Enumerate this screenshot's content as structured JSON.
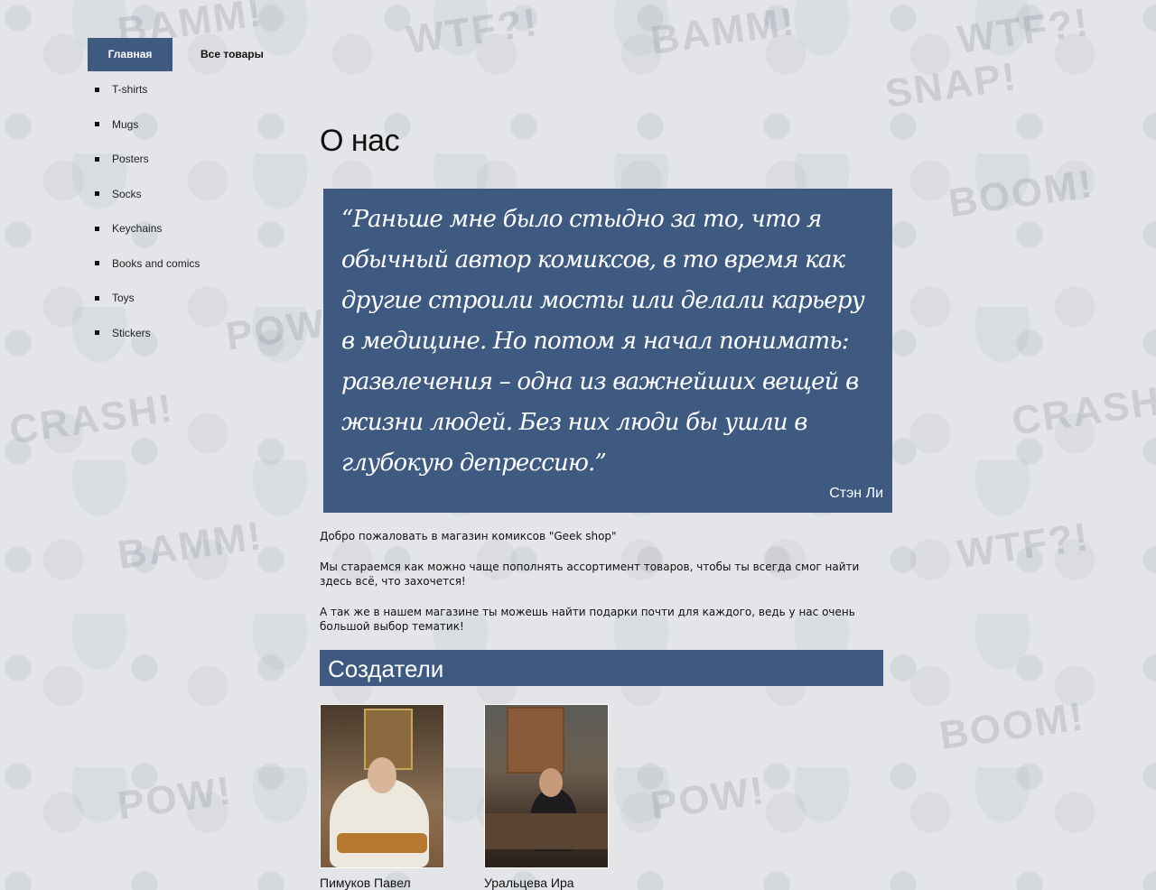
{
  "nav": {
    "tabs": [
      {
        "label": "Главная",
        "active": true
      },
      {
        "label": "Все товары",
        "active": false
      }
    ]
  },
  "sidebar": {
    "items": [
      {
        "label": "T-shirts"
      },
      {
        "label": "Mugs"
      },
      {
        "label": "Posters"
      },
      {
        "label": "Socks"
      },
      {
        "label": "Keychains"
      },
      {
        "label": "Books and comics"
      },
      {
        "label": "Toys"
      },
      {
        "label": "Stickers"
      }
    ]
  },
  "main": {
    "title": "О нас",
    "quote": {
      "text": "“Раньше мне было стыдно за то, что я обычный автор комиксов, в то время как другие строили мосты или делали карьеру в медицине. Но потом я начал понимать: развлечения – одна из важнейших вещей в жизни людей. Без них люди бы ушли в глубокую депрессию.”",
      "author": "Стэн Ли"
    },
    "paragraphs": [
      "Добро пожаловать в магазин комиксов \"Geek shop\"",
      "Мы стараемся как можно чаще пополнять ассортимент товаров, чтобы ты всегда смог найти здесь всё, что захочется!",
      "А так же в нашем магазине ты можешь найти подарки почти для каждого, ведь у нас очень большой выбор тематик!"
    ],
    "creators_title": "Создатели",
    "creators": [
      {
        "name": "Пимуков Павел"
      },
      {
        "name": "Уральцева Ира"
      }
    ]
  },
  "colors": {
    "accent": "#3f5a80",
    "background": "#e3e5e8"
  }
}
